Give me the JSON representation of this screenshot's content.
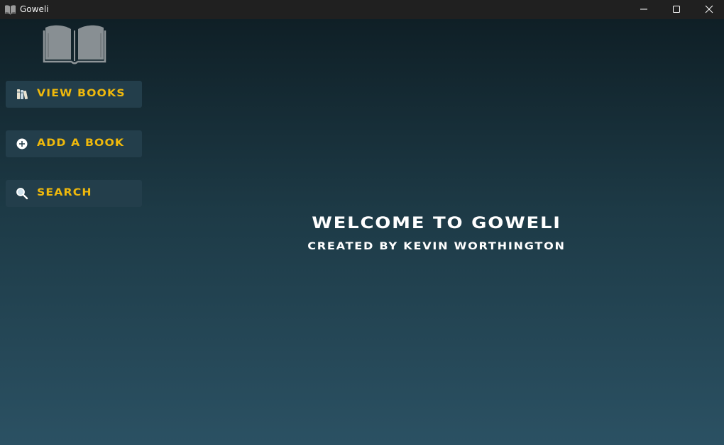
{
  "window": {
    "title": "Goweli",
    "controls": [
      "minimize-icon",
      "maximize-icon",
      "close-icon"
    ]
  },
  "sidebar": {
    "logo": "open-book-icon",
    "items": [
      {
        "label": "VIEW BOOKS",
        "icon": "books-icon"
      },
      {
        "label": "ADD A BOOK",
        "icon": "plus-circle-icon"
      },
      {
        "label": "SEARCH",
        "icon": "search-icon"
      }
    ]
  },
  "main": {
    "title": "WELCOME TO GOWELI",
    "subtitle": "CREATED BY KEVIN WORTHINGTON"
  },
  "colors": {
    "accent": "#f0b90b",
    "button_bg": "#233e4b",
    "titlebar": "#202020",
    "gradient_top": "#0f1f26",
    "gradient_bottom": "#2b5163"
  }
}
